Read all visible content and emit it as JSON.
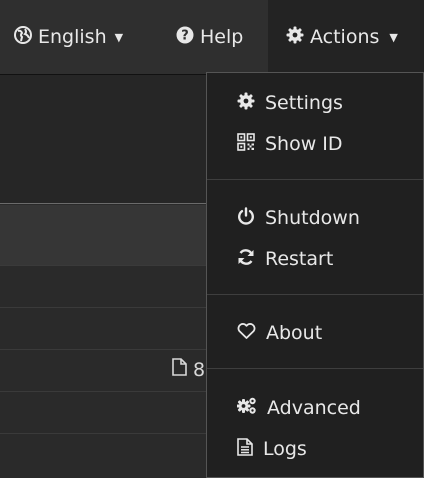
{
  "navbar": {
    "language_label": "English",
    "help_label": "Help",
    "actions_label": "Actions"
  },
  "content": {
    "file_fragment": "8"
  },
  "actions_menu": {
    "items": [
      {
        "label": "Settings",
        "icon": "cog-icon"
      },
      {
        "label": "Show ID",
        "icon": "qrcode-icon"
      },
      {
        "label": "Shutdown",
        "icon": "power-icon"
      },
      {
        "label": "Restart",
        "icon": "refresh-icon"
      },
      {
        "label": "About",
        "icon": "heart-icon"
      },
      {
        "label": "Advanced",
        "icon": "cogs-icon"
      },
      {
        "label": "Logs",
        "icon": "file-text-icon"
      }
    ]
  },
  "colors": {
    "navbar_bg": "#2f2f2f",
    "menu_bg": "#202020",
    "text": "#e8e8e8"
  }
}
